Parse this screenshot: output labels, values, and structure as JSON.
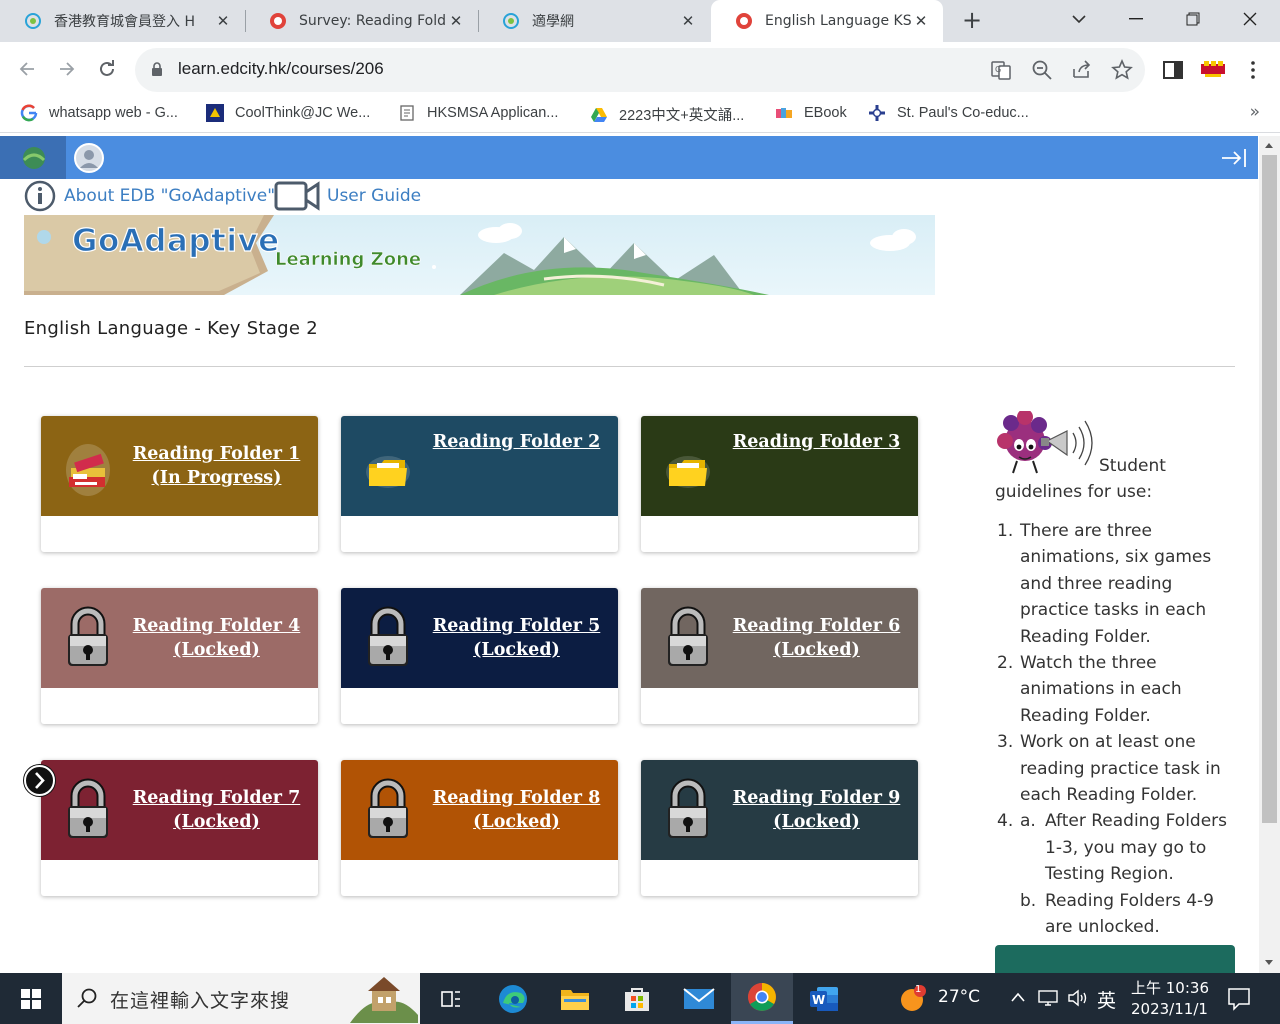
{
  "browser": {
    "tabs": [
      {
        "title": "香港教育城會員登入 H",
        "active": false
      },
      {
        "title": "Survey: Reading Fold",
        "active": false
      },
      {
        "title": "適學網",
        "active": false
      },
      {
        "title": "English Language KS",
        "active": true
      }
    ],
    "url": "learn.edcity.hk/courses/206",
    "bookmarks": [
      {
        "label": "whatsapp web - G...",
        "icon": "google-icon"
      },
      {
        "label": "CoolThink@JC We...",
        "icon": "coolthink-icon"
      },
      {
        "label": "HKSMSA Applican...",
        "icon": "document-icon"
      },
      {
        "label": "2223中文+英文誦...",
        "icon": "drive-icon"
      },
      {
        "label": "EBook",
        "icon": "ebook-icon"
      },
      {
        "label": "St. Paul's Co-educ...",
        "icon": "school-crest-icon"
      }
    ],
    "more_bookmarks": "»"
  },
  "page": {
    "about_link": "About EDB \"GoAdaptive\"",
    "user_guide_link": "User Guide",
    "banner_title": "GoAdaptive",
    "banner_subtitle": "Learning Zone",
    "course_title": "English Language - Key Stage 2",
    "folders": [
      {
        "line1": "Reading Folder 1",
        "line2": "(In Progress)",
        "color": "#8c6414",
        "icon": "books-icon"
      },
      {
        "line1": "Reading Folder 2",
        "line2": "",
        "color": "#1e4a63",
        "icon": "folder-icon"
      },
      {
        "line1": "Reading Folder 3",
        "line2": "",
        "color": "#2a3a16",
        "icon": "folder-icon"
      },
      {
        "line1": "Reading Folder 4",
        "line2": "(Locked)",
        "color": "#9c6b67",
        "icon": "padlock-icon"
      },
      {
        "line1": "Reading Folder 5",
        "line2": "(Locked)",
        "color": "#0c1d42",
        "icon": "padlock-icon"
      },
      {
        "line1": "Reading Folder 6",
        "line2": "(Locked)",
        "color": "#716660",
        "icon": "padlock-icon"
      },
      {
        "line1": "Reading Folder 7",
        "line2": "(Locked)",
        "color": "#7d2232",
        "icon": "padlock-icon"
      },
      {
        "line1": "Reading Folder 8",
        "line2": "(Locked)",
        "color": "#b15305",
        "icon": "padlock-icon"
      },
      {
        "line1": "Reading Folder 9",
        "line2": "(Locked)",
        "color": "#263b44",
        "icon": "padlock-icon"
      }
    ],
    "guidelines": {
      "heading_line1": "Student",
      "heading_line2": "guidelines for use:",
      "items": [
        {
          "num": "1.",
          "text": "There are three animations, six games and three reading practice tasks in each Reading Folder."
        },
        {
          "num": "2.",
          "text": "Watch the three animations in each Reading Folder."
        },
        {
          "num": "3.",
          "text": "Work on at least one reading practice task in each Reading Folder."
        }
      ],
      "item4_num": "4.",
      "item4_subs": [
        {
          "num": "a.",
          "text": "After Reading Folders 1-3, you may go to Testing Region."
        },
        {
          "num": "b.",
          "text": "Reading Folders 4-9 are unlocked."
        }
      ]
    }
  },
  "taskbar": {
    "search_placeholder": "在這裡輸入文字來搜",
    "weather": "27°C",
    "weather_badge": "1",
    "ime": "英",
    "time": "上午 10:36",
    "date": "2023/11/1"
  }
}
